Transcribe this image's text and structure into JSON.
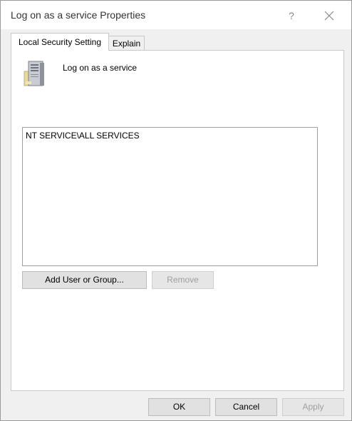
{
  "window": {
    "title": "Log on as a service Properties",
    "help_glyph": "?",
    "close_glyph": "✕"
  },
  "tabs": [
    {
      "label": "Local Security Setting",
      "active": true
    },
    {
      "label": "Explain",
      "active": false
    }
  ],
  "policy": {
    "name": "Log on as a service",
    "icon": "server-tower-icon"
  },
  "members": [
    "NT SERVICE\\ALL SERVICES"
  ],
  "buttons": {
    "add": "Add User or Group...",
    "remove": "Remove",
    "ok": "OK",
    "cancel": "Cancel",
    "apply": "Apply"
  },
  "colors": {
    "dialog_bg": "#f0f0f0",
    "button_bg": "#e1e1e1",
    "disabled_text": "#a0a0a0"
  }
}
